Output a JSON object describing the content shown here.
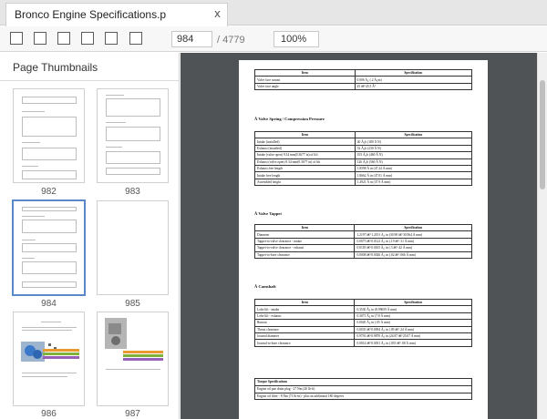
{
  "tab": {
    "title": "Bronco Engine Specifications.p",
    "close": "x"
  },
  "toolbar": {
    "page_value": "984",
    "page_total": "/ 4779",
    "zoom_value": "100%"
  },
  "sidebar": {
    "title": "Page Thumbnails",
    "thumbnails": [
      {
        "label": "982"
      },
      {
        "label": "983"
      },
      {
        "label": "984"
      },
      {
        "label": "985"
      },
      {
        "label": "986"
      },
      {
        "label": "987"
      }
    ]
  },
  "page": {
    "table1": {
      "header": [
        "Item",
        "Specification"
      ],
      "rows": [
        [
          "Valve face runout",
          "0.006 Ã¿ (.2 Ã¿m)"
        ],
        [
          "Valve face angle",
          "45 â€“45.5 Â°"
        ]
      ]
    },
    "section_spring": "Â Valve Spring / Compression Pressure",
    "table2": {
      "header": [
        "Item",
        "Specification"
      ],
      "rows": [
        [
          "Intake (installed)",
          "40 Ã¿b (180 Ã N)"
        ],
        [
          "Exhaust (installed)",
          "52 Ã¿b (230 Ã N)"
        ],
        [
          "Intake (valve open) 9.34 mm(0.3677 in) of lift",
          "103 Ã¿b (460 Ã N)"
        ],
        [
          "Exhaust (valve open) 9.34 mm(0.3677 in) of lift",
          "126 Ã¿b (560 Ã N)"
        ],
        [
          "Exhaust free length",
          "1.8598 Ã in (47.24 Ã mm)"
        ],
        [
          "Intake free length",
          "1.8662 Ã in (47.01 Ã mm)"
        ],
        [
          "Assembled height",
          "1.4921 Ã in (37.9 Ã mm)"
        ]
      ]
    },
    "section_tappet": "Â Valve Tappet",
    "table3": {
      "header": [
        "Item",
        "Specification"
      ],
      "rows": [
        [
          "Diameter",
          "1.2197 â€“1.2191 Ã¿ in (30.98 â€“30.964 Ã mm)"
        ],
        [
          "Tappet-to-valve clearance - intake",
          "0.0075 â€“0.0122 Ã¿ in (.19 â€“.31 Ã mm)"
        ],
        [
          "Tappet-to-valve clearance - exhaust",
          "0.0118 â€“0.0165 Ã¿ in (.3 â€“.42 Ã mm)"
        ],
        [
          "Tappet-to-bore clearance",
          "0.0008 â€“0.0026 Ã¿ in (.02 â€“.066 Ã mm)"
        ]
      ]
    },
    "section_camshaft": "Â Camshaft",
    "table4": {
      "header": [
        "Item",
        "Specification"
      ],
      "rows": [
        [
          "Lobe lift - intake",
          "0.3530 Ã¿ in (8.99659 Ã mm)"
        ],
        [
          "Lobe lift - exhaust",
          "0.3071 Ã¿ in (7.8 Ã mm)"
        ],
        [
          "Runout",
          "0.0020 Ã¿ in (.05 Ã mm)"
        ],
        [
          "Thrust clearance",
          "0.0035 â€“0.0094 Ã¿ in (.09 â€“.24 Ã mm)"
        ],
        [
          "Journal diameter",
          "0.9791 â€“0.9870 Ã¿ in (24.87 â€“25.07 Ã mm)"
        ],
        [
          "Journal-to-bore clearance",
          "0.0014 â€“0.0031 Ã¿ in (.035 â€“.08 Ã mm)"
        ]
      ]
    },
    "torque": {
      "title": "Torque Specifications",
      "rows": [
        "Engine oil pan drain plug - 27 Nm (20 lb-ft)",
        "Engine oil filter - 8 Nm (71 lb-in) - plus an additional 180 degrees"
      ]
    }
  }
}
